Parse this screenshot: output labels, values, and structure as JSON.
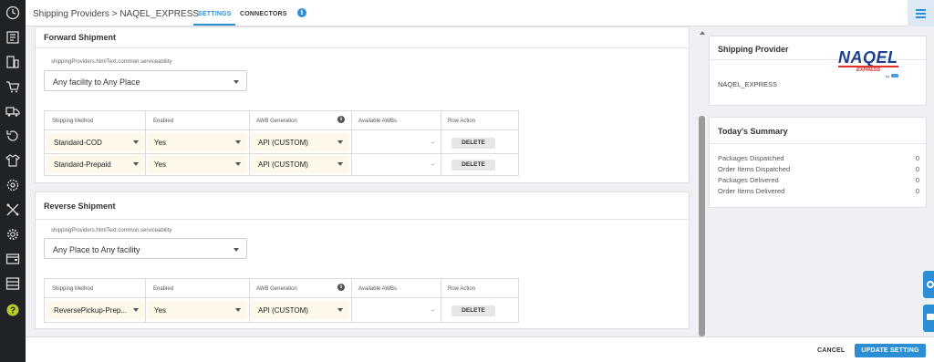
{
  "header": {
    "breadcrumb": "Shipping Providers > NAQEL_EXPRESS",
    "tabs": [
      {
        "label": "SETTINGS",
        "active": true
      },
      {
        "label": "CONNECTORS",
        "active": false
      }
    ],
    "info_icon": "info-icon",
    "menu_icon": "hamburger-menu-icon"
  },
  "nav": {
    "icons": [
      "dashboard-icon",
      "orders-icon",
      "devices-icon",
      "cart-icon",
      "truck-icon",
      "returns-icon",
      "apparel-icon",
      "gear-settings-icon",
      "tools-icon",
      "settings-icon",
      "wallet-icon",
      "reports-icon",
      "help-icon"
    ]
  },
  "forward": {
    "title": "Forward Shipment",
    "serviceability_label": "shippingProviders.htmlText.common.serviceability",
    "serviceability_value": "Any facility to Any Place",
    "columns": [
      "Shipping Method",
      "Enabled",
      "AWB Generation",
      "Available AWBs",
      "Row Action"
    ],
    "rows": [
      {
        "method": "Standard-COD",
        "enabled": "Yes",
        "awb": "API (CUSTOM)",
        "available": "",
        "action": "DELETE"
      },
      {
        "method": "Standard-Prepaid",
        "enabled": "Yes",
        "awb": "API (CUSTOM)",
        "available": "",
        "action": "DELETE"
      }
    ]
  },
  "reverse": {
    "title": "Reverse Shipment",
    "serviceability_label": "shippingProviders.htmlText.common.serviceability",
    "serviceability_value": "Any Place to Any facility",
    "columns": [
      "Shipping Method",
      "Enabled",
      "AWB Generation",
      "Available AWBs",
      "Row Action"
    ],
    "rows": [
      {
        "method": "ReversePickup-Prep...",
        "enabled": "Yes",
        "awb": "API (CUSTOM)",
        "available": "",
        "action": "DELETE"
      }
    ]
  },
  "provider": {
    "title": "Shipping Provider",
    "name": "NAQEL_EXPRESS",
    "logo_text": "NAQEL",
    "logo_sub": "EXPRESS",
    "logo_by": "by"
  },
  "summary": {
    "title": "Today's Summary",
    "items": [
      {
        "label": "Packages Dispatched",
        "value": "0"
      },
      {
        "label": "Order Items Dispatched",
        "value": "0"
      },
      {
        "label": "Packages Delivered",
        "value": "0"
      },
      {
        "label": "Order Items Delivered",
        "value": "0"
      }
    ]
  },
  "footer": {
    "cancel": "CANCEL",
    "update": "UPDATE SETTING"
  },
  "colors": {
    "accent": "#2c8fd6",
    "rail": "#1f2326",
    "field_bg": "#fdf8ea",
    "logo_blue": "#1c3f94",
    "logo_red": "#e0302a"
  }
}
